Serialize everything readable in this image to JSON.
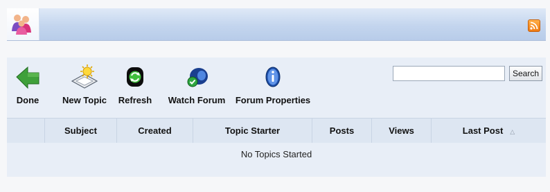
{
  "header": {
    "logo_icon": "forum-users-icon",
    "rss_icon": "rss-feed-icon",
    "accent_color": "#c3d5ee"
  },
  "toolbar": {
    "buttons": [
      {
        "label": "Done",
        "icon": "back-arrow-icon"
      },
      {
        "label": "New Topic",
        "icon": "new-topic-icon"
      },
      {
        "label": "Refresh",
        "icon": "refresh-icon"
      },
      {
        "label": "Watch Forum",
        "icon": "watch-forum-icon"
      },
      {
        "label": "Forum Properties",
        "icon": "forum-properties-icon"
      }
    ]
  },
  "search": {
    "value": "",
    "button_label": "Search"
  },
  "table": {
    "columns": [
      "",
      "Subject",
      "Created",
      "Topic Starter",
      "Posts",
      "Views",
      "Last Post"
    ],
    "sorted_column": "Last Post",
    "sort_icon": "sort-ascending-icon",
    "empty_message": "No Topics Started"
  }
}
